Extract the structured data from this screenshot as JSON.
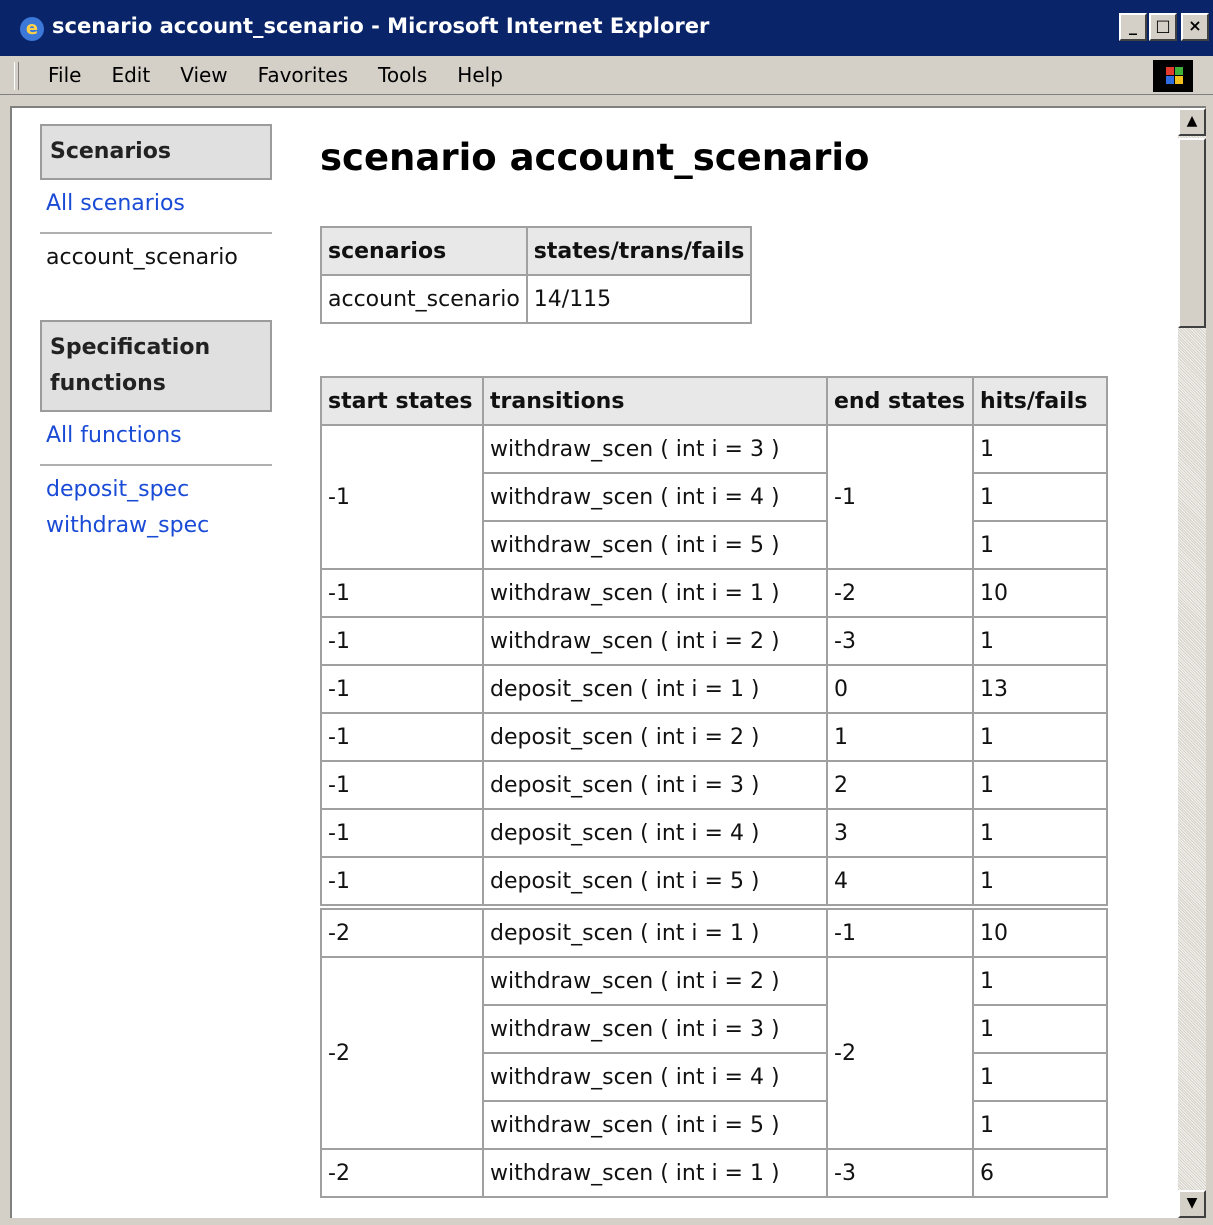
{
  "window": {
    "title": "scenario account_scenario - Microsoft Internet Explorer",
    "buttons": {
      "minimize": "_",
      "maximize": "□",
      "close": "×"
    }
  },
  "menu": {
    "items": [
      {
        "label": "File"
      },
      {
        "label": "Edit"
      },
      {
        "label": "View"
      },
      {
        "label": "Favorites"
      },
      {
        "label": "Tools"
      },
      {
        "label": "Help"
      }
    ]
  },
  "sidebar": {
    "scenarios_heading": "Scenarios",
    "all_scenarios": "All scenarios",
    "current_scenario": "account_scenario",
    "spec_heading_line1": "Specification",
    "spec_heading_line2": "functions",
    "all_functions": "All functions",
    "functions": [
      "deposit_spec",
      "withdraw_spec"
    ]
  },
  "main": {
    "title": "scenario account_scenario",
    "summary": {
      "headers": [
        "scenarios",
        "states/trans/fails"
      ],
      "row": [
        "account_scenario",
        "14/115"
      ]
    },
    "table": {
      "headers": [
        "start states",
        "transitions",
        "end states",
        "hits/fails"
      ],
      "rows": [
        {
          "start": "-1",
          "transition": "withdraw_scen ( int i = 3 )",
          "end": "-1",
          "hits": "1"
        },
        {
          "start": "",
          "transition": "withdraw_scen ( int i = 4 )",
          "end": "",
          "hits": "1"
        },
        {
          "start": "",
          "transition": "withdraw_scen ( int i = 5 )",
          "end": "",
          "hits": "1"
        },
        {
          "start": "-1",
          "transition": "withdraw_scen ( int i = 1 )",
          "end": "-2",
          "hits": "10"
        },
        {
          "start": "-1",
          "transition": "withdraw_scen ( int i = 2 )",
          "end": "-3",
          "hits": "1"
        },
        {
          "start": "-1",
          "transition": "deposit_scen ( int i = 1 )",
          "end": "0",
          "hits": "13"
        },
        {
          "start": "-1",
          "transition": "deposit_scen ( int i = 2 )",
          "end": "1",
          "hits": "1"
        },
        {
          "start": "-1",
          "transition": "deposit_scen ( int i = 3 )",
          "end": "2",
          "hits": "1"
        },
        {
          "start": "-1",
          "transition": "deposit_scen ( int i = 4 )",
          "end": "3",
          "hits": "1"
        },
        {
          "start": "-1",
          "transition": "deposit_scen ( int i = 5 )",
          "end": "4",
          "hits": "1"
        },
        {
          "start": "-2",
          "transition": "deposit_scen ( int i = 1 )",
          "end": "-1",
          "hits": "10"
        },
        {
          "start": "-2",
          "transition": "withdraw_scen ( int i = 2 )",
          "end": "-2",
          "hits": "1"
        },
        {
          "start": "",
          "transition": "withdraw_scen ( int i = 3 )",
          "end": "",
          "hits": "1"
        },
        {
          "start": "",
          "transition": "withdraw_scen ( int i = 4 )",
          "end": "",
          "hits": "1"
        },
        {
          "start": "",
          "transition": "withdraw_scen ( int i = 5 )",
          "end": "",
          "hits": "1"
        },
        {
          "start": "-2",
          "transition": "withdraw_scen ( int i = 1 )",
          "end": "-3",
          "hits": "6"
        }
      ]
    }
  },
  "colors": {
    "titlebar": "#0a246a",
    "link": "#1a4bd6",
    "chrome": "#d4d0c8"
  }
}
